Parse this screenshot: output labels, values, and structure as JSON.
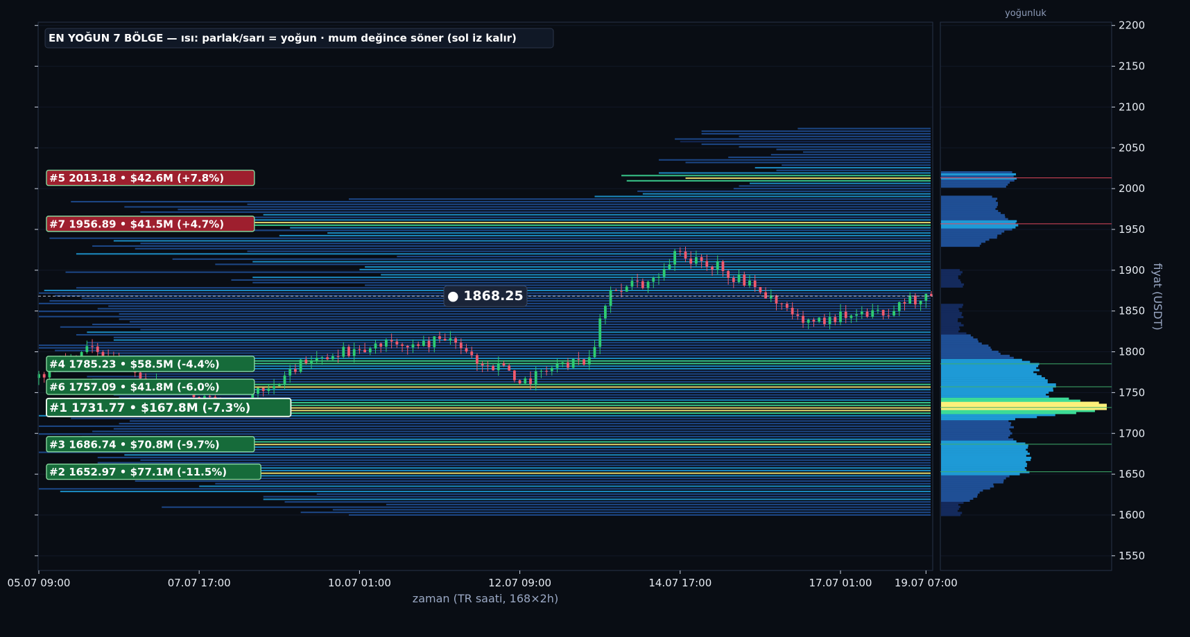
{
  "chart_data": {
    "type": "candlestick-heatmap",
    "title": "EN YOĞUN 7 BÖLGE — ısı: parlak/sarı = yoğun · mum değince söner (sol iz kalır)",
    "xlabel": "zaman (TR saati, 168×2h)",
    "ylabel": "fiyat (USDT)",
    "profile_label": "yoğunluk",
    "ylim": [
      1532,
      2204
    ],
    "yticks": [
      1550,
      1600,
      1650,
      1700,
      1750,
      1800,
      1850,
      1900,
      1950,
      2000,
      2050,
      2100,
      2150,
      2200
    ],
    "xticks": [
      "05.07 09:00",
      "07.07 17:00",
      "10.07 01:00",
      "12.07 09:00",
      "14.07 17:00",
      "17.07 01:00",
      "19.07 07:00"
    ],
    "current_price": 1868.25,
    "current_price_label": "● 1868.25",
    "colors": {
      "background": "#090d14",
      "up": "#2ecc71",
      "down": "#f05a6e",
      "heat_low": "#1a3a7a",
      "heat_mid": "#1e9ad6",
      "heat_high": "#3ddc97",
      "heat_peak": "#fdf07a",
      "label_above": "#9e1f2e",
      "label_below": "#166b3a"
    },
    "zones": [
      {
        "rank": 1,
        "price": 1731.77,
        "label": "#1  1731.77  •  $167.8M  (-7.3%)",
        "side": "below"
      },
      {
        "rank": 2,
        "price": 1652.97,
        "label": "#2  1652.97  •  $77.1M  (-11.5%)",
        "side": "below"
      },
      {
        "rank": 3,
        "price": 1686.74,
        "label": "#3  1686.74  •  $70.8M  (-9.7%)",
        "side": "below"
      },
      {
        "rank": 4,
        "price": 1785.23,
        "label": "#4  1785.23  •  $58.5M  (-4.4%)",
        "side": "below"
      },
      {
        "rank": 5,
        "price": 2013.18,
        "label": "#5  2013.18  •  $42.6M  (+7.8%)",
        "side": "above"
      },
      {
        "rank": 6,
        "price": 1757.09,
        "label": "#6  1757.09  •  $41.8M  (-6.0%)",
        "side": "below"
      },
      {
        "rank": 7,
        "price": 1956.89,
        "label": "#7  1956.89  •  $41.5M  (+4.7%)",
        "side": "above"
      }
    ],
    "price_path": [
      [
        0,
        1768
      ],
      [
        6,
        1790
      ],
      [
        12,
        1805
      ],
      [
        18,
        1778
      ],
      [
        22,
        1765
      ],
      [
        28,
        1750
      ],
      [
        34,
        1742
      ],
      [
        38,
        1728
      ],
      [
        42,
        1755
      ],
      [
        46,
        1760
      ],
      [
        50,
        1785
      ],
      [
        56,
        1800
      ],
      [
        62,
        1798
      ],
      [
        66,
        1815
      ],
      [
        70,
        1800
      ],
      [
        74,
        1812
      ],
      [
        78,
        1818
      ],
      [
        82,
        1795
      ],
      [
        88,
        1778
      ],
      [
        92,
        1765
      ],
      [
        96,
        1775
      ],
      [
        100,
        1785
      ],
      [
        104,
        1790
      ],
      [
        108,
        1878
      ],
      [
        112,
        1880
      ],
      [
        116,
        1885
      ],
      [
        120,
        1920
      ],
      [
        124,
        1912
      ],
      [
        128,
        1905
      ],
      [
        132,
        1888
      ],
      [
        136,
        1875
      ],
      [
        140,
        1855
      ],
      [
        144,
        1832
      ],
      [
        148,
        1840
      ],
      [
        152,
        1846
      ],
      [
        156,
        1843
      ],
      [
        160,
        1850
      ],
      [
        164,
        1862
      ],
      [
        167,
        1868
      ]
    ]
  }
}
